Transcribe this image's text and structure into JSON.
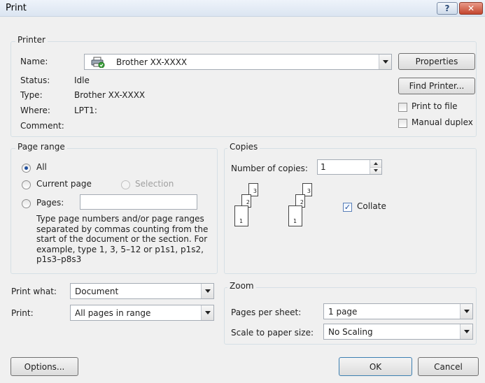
{
  "window": {
    "title": "Print"
  },
  "printer": {
    "group_label": "Printer",
    "name_label": "Name:",
    "name_value": "Brother XX-XXXX",
    "status_label": "Status:",
    "status_value": "Idle",
    "type_label": "Type:",
    "type_value": "Brother XX-XXXX",
    "where_label": "Where:",
    "where_value": "LPT1:",
    "comment_label": "Comment:",
    "properties_label": "Properties",
    "find_printer_label": "Find Printer...",
    "print_to_file_label": "Print to file",
    "manual_duplex_label": "Manual duplex"
  },
  "page_range": {
    "group_label": "Page range",
    "all_label": "All",
    "current_page_label": "Current page",
    "selection_label": "Selection",
    "pages_label": "Pages:",
    "pages_value": "",
    "help_text": "Type page numbers and/or page ranges separated by commas counting from the start of the document or the section. For example, type 1, 3, 5–12 or p1s1, p1s2, p1s3–p8s3"
  },
  "copies": {
    "group_label": "Copies",
    "number_label": "Number of copies:",
    "number_value": "1",
    "collate_label": "Collate",
    "page_numbers": [
      "1",
      "2",
      "3"
    ]
  },
  "print_what": {
    "label": "Print what:",
    "value": "Document"
  },
  "print": {
    "label": "Print:",
    "value": "All pages in range"
  },
  "zoom": {
    "group_label": "Zoom",
    "pages_per_sheet_label": "Pages per sheet:",
    "pages_per_sheet_value": "1 page",
    "scale_label": "Scale to paper size:",
    "scale_value": "No Scaling"
  },
  "buttons": {
    "options": "Options...",
    "ok": "OK",
    "cancel": "Cancel"
  }
}
